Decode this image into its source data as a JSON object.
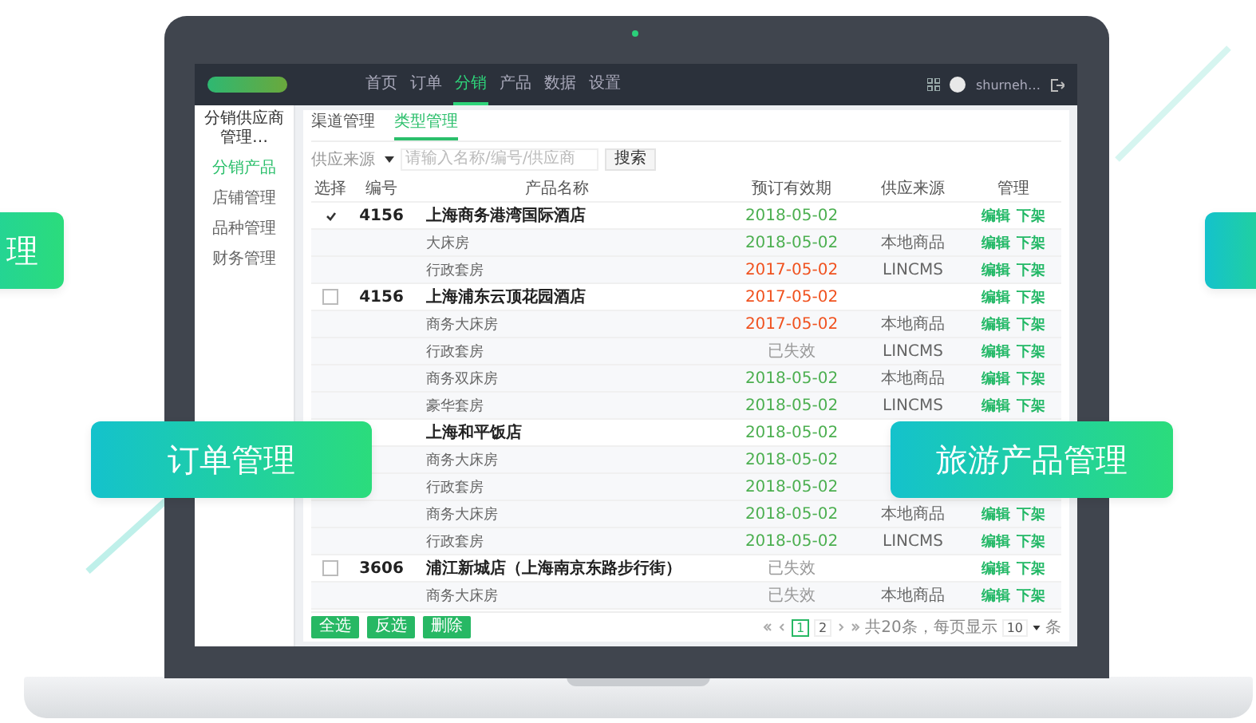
{
  "app": {
    "nav": [
      {
        "label": "首页",
        "selected": false
      },
      {
        "label": "订单",
        "selected": false
      },
      {
        "label": "分销",
        "selected": true
      },
      {
        "label": "产品",
        "selected": false
      },
      {
        "label": "数据",
        "selected": false
      },
      {
        "label": "设置",
        "selected": false
      }
    ],
    "user": "shurneh…",
    "sidebar": {
      "title": "分销供应商管理…",
      "items": [
        {
          "label": "分销产品",
          "selected": true
        },
        {
          "label": "店铺管理",
          "selected": false
        },
        {
          "label": "品种管理",
          "selected": false
        },
        {
          "label": "财务管理",
          "selected": false
        }
      ]
    },
    "tabs": [
      {
        "label": "渠道管理",
        "selected": false
      },
      {
        "label": "类型管理",
        "selected": true
      }
    ],
    "filter": {
      "select": "供应来源",
      "placeholder": "请输入名称/编号/供应商",
      "button": "搜索"
    },
    "table": {
      "columns": [
        "选择",
        "编号",
        "产品名称",
        "预订有效期",
        "供应来源",
        "管理"
      ],
      "rows": [
        {
          "kind": "hotel",
          "checked": true,
          "code": "4156",
          "name": "上海商务港湾国际酒店",
          "date": "2018-05-02",
          "color": "#4caf50",
          "actions": [
            "编辑",
            "下架"
          ]
        },
        {
          "kind": "room",
          "name": "大床房",
          "date": "2018-05-02",
          "color": "#4caf50",
          "source": "本地商品",
          "actions": [
            "编辑",
            "下架"
          ]
        },
        {
          "kind": "room",
          "name": "行政套房",
          "date": "2017-05-02",
          "color": "#f0521f",
          "source": "LINCMS",
          "actions": [
            "编辑",
            "下架"
          ]
        },
        {
          "kind": "hotel",
          "checked": false,
          "code": "4156",
          "name": "上海浦东云顶花园酒店",
          "date": "2017-05-02",
          "color": "#f0521f",
          "actions": [
            "编辑",
            "下架"
          ]
        },
        {
          "kind": "room",
          "name": "商务大床房",
          "date": "2017-05-02",
          "color": "#f0521f",
          "source": "本地商品",
          "actions": [
            "编辑",
            "下架"
          ]
        },
        {
          "kind": "room",
          "name": "行政套房",
          "date": "已失效",
          "color": "#999999",
          "source": "LINCMS",
          "actions": [
            "编辑",
            "下架"
          ]
        },
        {
          "kind": "room",
          "name": "商务双床房",
          "date": "2018-05-02",
          "color": "#4caf50",
          "source": "本地商品",
          "actions": [
            "编辑",
            "下架"
          ]
        },
        {
          "kind": "room",
          "name": "豪华套房",
          "date": "2018-05-02",
          "color": "#4caf50",
          "source": "LINCMS",
          "actions": [
            "编辑",
            "下架"
          ]
        },
        {
          "kind": "hotel",
          "name": "上海和平饭店",
          "date": "2018-05-02",
          "color": "#4caf50"
        },
        {
          "kind": "room",
          "name": "商务大床房",
          "date": "2018-05-02",
          "color": "#4caf50"
        },
        {
          "kind": "room",
          "name": "行政套房",
          "date": "2018-05-02",
          "color": "#4caf50"
        },
        {
          "kind": "room",
          "name": "商务大床房",
          "date": "2018-05-02",
          "color": "#4caf50",
          "source": "本地商品",
          "actions": [
            "编辑",
            "下架"
          ]
        },
        {
          "kind": "room",
          "name": "行政套房",
          "date": "2018-05-02",
          "color": "#4caf50",
          "source": "LINCMS",
          "actions": [
            "编辑",
            "下架"
          ]
        },
        {
          "kind": "hotel",
          "checked": false,
          "code": "3606",
          "name": "浦江新城店（上海南京东路步行街）",
          "date": "已失效",
          "color": "#999999",
          "actions": [
            "编辑",
            "下架"
          ]
        },
        {
          "kind": "room",
          "name": "商务大床房",
          "date": "已失效",
          "color": "#999999",
          "source": "本地商品",
          "actions": [
            "编辑",
            "下架"
          ]
        }
      ]
    },
    "footer_buttons": [
      "全选",
      "反选",
      "删除"
    ],
    "pagination": {
      "pages": [
        {
          "label": "1",
          "selected": true
        },
        {
          "label": "2",
          "selected": false
        }
      ],
      "summary": "共20条，每页显示",
      "page_size": "10",
      "unit": "条"
    }
  },
  "badges": [
    {
      "kind": "left-edge",
      "label": "理"
    },
    {
      "kind": "left",
      "label": "订单管理"
    },
    {
      "kind": "right",
      "label": "旅游产品管理"
    },
    {
      "kind": "right-edge"
    }
  ]
}
